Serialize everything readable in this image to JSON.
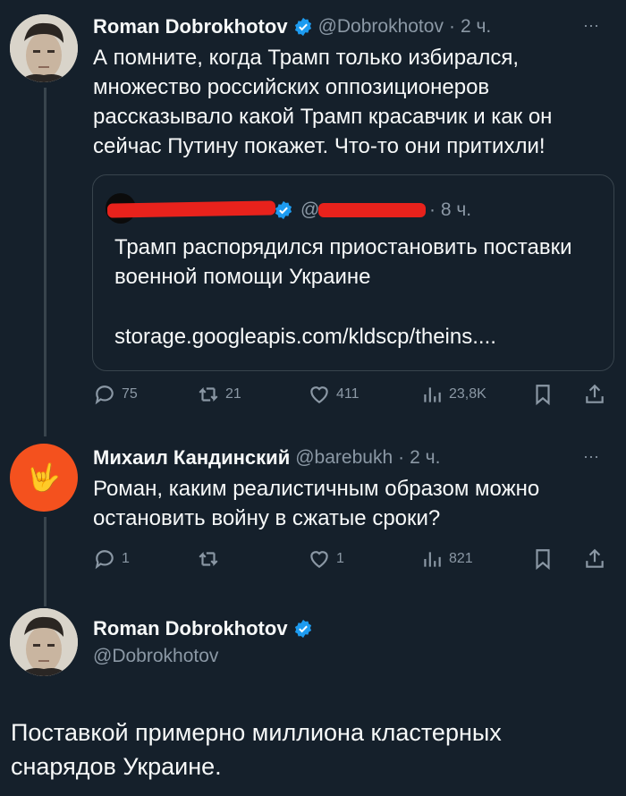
{
  "tweet1": {
    "author": "Roman Dobrokhotov",
    "handle": "@Dobrokhotov",
    "sep": "·",
    "time": "2 ч.",
    "more": "···",
    "text": "А помните, когда Трамп только избирался, множество российских оппозиционеров рассказывало какой Трамп красавчик и как он сейчас Путину покажет. Что-то они притихли!",
    "quote": {
      "at": "@",
      "time": "· 8 ч.",
      "text": "Трамп распорядился приостановить поставки военной помощи Украине",
      "link": "storage.googleapis.com/kldscp/theins...."
    },
    "actions": {
      "replies": "75",
      "retweets": "21",
      "likes": "411",
      "views": "23,8K"
    }
  },
  "tweet2": {
    "author": "Михаил Кандинский",
    "handle": "@barebukh",
    "sep": "·",
    "time": "2 ч.",
    "more": "···",
    "avatar_emoji": "🤟",
    "text": "Роман, каким реалистичным образом можно остановить войну в сжатые сроки?",
    "actions": {
      "replies": "1",
      "retweets": "",
      "likes": "1",
      "views": "821"
    }
  },
  "tweet3": {
    "author": "Roman Dobrokhotov",
    "handle": "@Dobrokhotov",
    "text": "Поставкой примерно миллиона кластерных снарядов Украине."
  },
  "colors": {
    "background": "#15202b",
    "verified": "#1d9bf0",
    "muted": "#8b98a5",
    "redaction": "#e8221c",
    "avatar2": "#f4511e"
  }
}
